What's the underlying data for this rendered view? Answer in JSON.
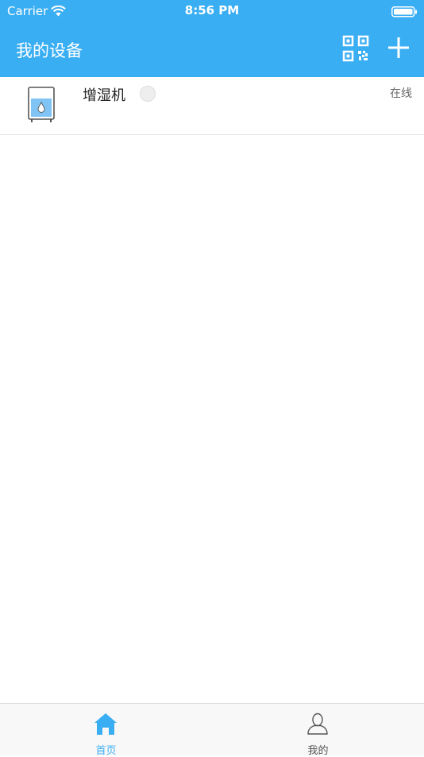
{
  "status_bar": {
    "carrier": "Carrier",
    "time": "8:56 PM"
  },
  "nav": {
    "title": "我的设备"
  },
  "devices": [
    {
      "name": "增湿机",
      "status": "在线"
    }
  ],
  "tab_bar": {
    "tabs": [
      {
        "label": "首页",
        "active": true
      },
      {
        "label": "我的",
        "active": false
      }
    ]
  },
  "colors": {
    "accent": "#3aaef3",
    "water": "#7fc4f5",
    "divider": "#e5e5e5"
  },
  "icons": [
    "wifi-icon",
    "battery-icon",
    "qr-code-icon",
    "plus-icon",
    "humidifier-icon",
    "home-icon",
    "person-icon"
  ]
}
